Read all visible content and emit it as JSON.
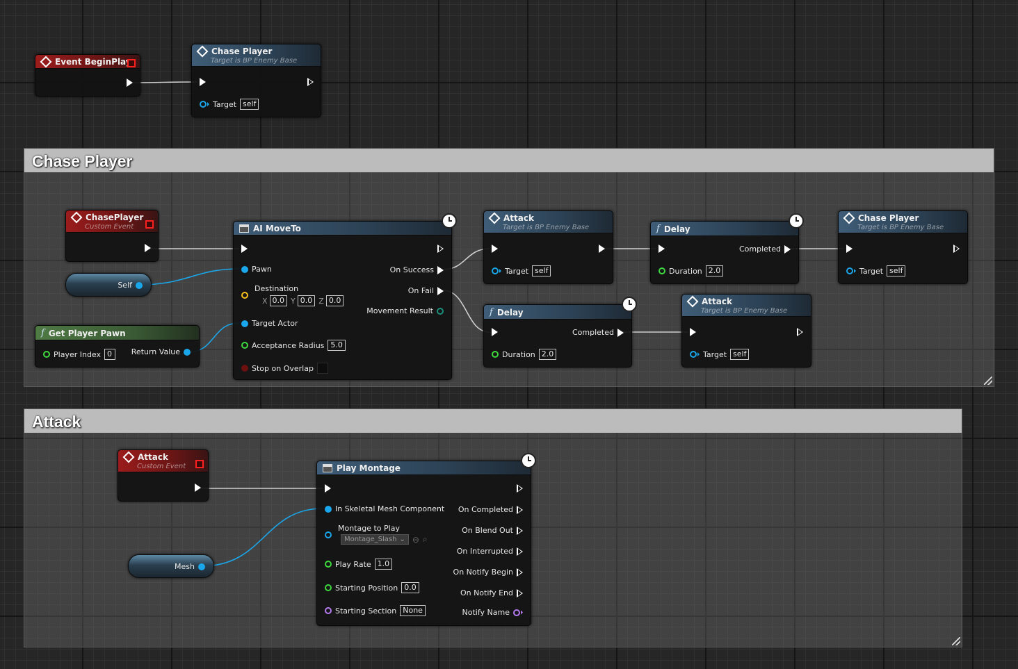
{
  "colors": {
    "exec": "#ffffff",
    "object": "#1aa6ea",
    "float": "#3fd93f",
    "vector": "#f7c21d",
    "name": "#b57bf0",
    "byte": "#1a8f7a",
    "bool": "#6b0f0f"
  },
  "top": {
    "event_begin_play": {
      "title": "Event BeginPlay",
      "icon": "event-diamond-icon"
    },
    "chase_player_call": {
      "title": "Chase Player",
      "subtitle": "Target is BP Enemy Base",
      "target_label": "Target",
      "target_value": "self"
    }
  },
  "comments": {
    "chase_player": "Chase Player",
    "attack": "Attack"
  },
  "chase_group": {
    "chaseplayer_event": {
      "title": "ChasePlayer",
      "subtitle": "Custom Event"
    },
    "self_node": {
      "label": "Self"
    },
    "get_player_pawn": {
      "title": "Get Player Pawn",
      "player_index_label": "Player Index",
      "player_index_value": "0",
      "return_label": "Return Value"
    },
    "ai_moveto": {
      "title": "AI MoveTo",
      "pawn": "Pawn",
      "destination": "Destination",
      "x_label": "X",
      "x": "0.0",
      "y_label": "Y",
      "y": "0.0",
      "z_label": "Z",
      "z": "0.0",
      "target_actor": "Target Actor",
      "acceptance_radius": "Acceptance Radius",
      "acceptance_radius_value": "5.0",
      "stop_on_overlap": "Stop on Overlap",
      "on_success": "On Success",
      "on_fail": "On Fail",
      "movement_result": "Movement Result"
    },
    "attack_call_1": {
      "title": "Attack",
      "subtitle": "Target is BP Enemy Base",
      "target_label": "Target",
      "target_value": "self"
    },
    "delay_1": {
      "title": "Delay",
      "completed": "Completed",
      "duration_label": "Duration",
      "duration_value": "2.0"
    },
    "chase_player_call_2": {
      "title": "Chase Player",
      "subtitle": "Target is BP Enemy Base",
      "target_label": "Target",
      "target_value": "self"
    },
    "delay_2": {
      "title": "Delay",
      "completed": "Completed",
      "duration_label": "Duration",
      "duration_value": "2.0"
    },
    "attack_call_2": {
      "title": "Attack",
      "subtitle": "Target is BP Enemy Base",
      "target_label": "Target",
      "target_value": "self"
    }
  },
  "attack_group": {
    "attack_event": {
      "title": "Attack",
      "subtitle": "Custom Event"
    },
    "mesh_node": {
      "label": "Mesh"
    },
    "play_montage": {
      "title": "Play Montage",
      "in_skeletal_mesh": "In Skeletal Mesh Component",
      "montage_to_play": "Montage to Play",
      "montage_value": "Montage_Slash",
      "play_rate": "Play Rate",
      "play_rate_value": "1.0",
      "starting_position": "Starting Position",
      "starting_position_value": "0.0",
      "starting_section": "Starting Section",
      "starting_section_value": "None",
      "on_completed": "On Completed",
      "on_blend_out": "On Blend Out",
      "on_interrupted": "On Interrupted",
      "on_notify_begin": "On Notify Begin",
      "on_notify_end": "On Notify End",
      "notify_name": "Notify Name"
    }
  }
}
